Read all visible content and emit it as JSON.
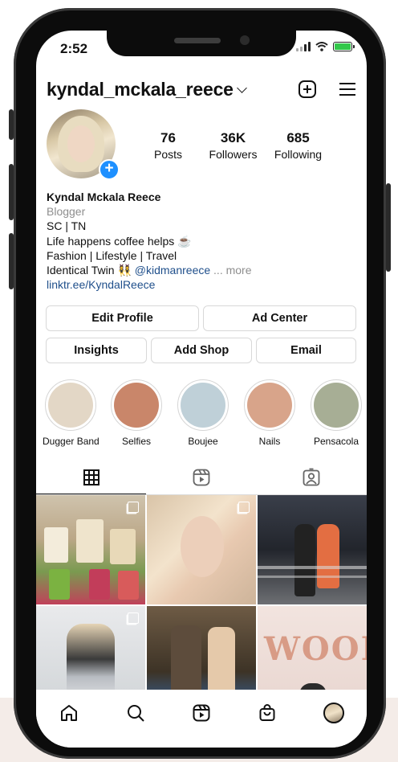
{
  "status_bar": {
    "time": "2:52"
  },
  "header": {
    "username": "kyndal_mckala_reece",
    "icons": [
      "new-post-icon",
      "menu-icon"
    ]
  },
  "profile": {
    "posts_count": "76",
    "posts_label": "Posts",
    "followers_count": "36K",
    "followers_label": "Followers",
    "following_count": "685",
    "following_label": "Following"
  },
  "bio": {
    "name": "Kyndal Mckala Reece",
    "category": "Blogger",
    "line1": "SC | TN",
    "line2": "Life happens coffee helps ☕",
    "line3": "Fashion | Lifestyle | Travel",
    "line4_prefix": "Identical Twin 👯‍♀️ ",
    "line4_mention": "@kidmanreece",
    "line4_more": " ... more",
    "link": "linktr.ee/KyndalReece"
  },
  "buttons": {
    "edit_profile": "Edit Profile",
    "ad_center": "Ad Center",
    "insights": "Insights",
    "add_shop": "Add Shop",
    "email": "Email"
  },
  "highlights": [
    {
      "label": "Dugger Band",
      "color": "#e3d7c6"
    },
    {
      "label": "Selfies",
      "color": "#c9866a"
    },
    {
      "label": "Boujee",
      "color": "#bfd0d8"
    },
    {
      "label": "Nails",
      "color": "#d8a48a"
    },
    {
      "label": "Pensacola",
      "color": "#a7ae95"
    }
  ],
  "tabs": [
    "grid-icon",
    "reels-icon",
    "tagged-icon"
  ],
  "colors": {
    "link": "#1f4f8b",
    "badge": "#1e90ff",
    "battery": "#32c84a"
  }
}
